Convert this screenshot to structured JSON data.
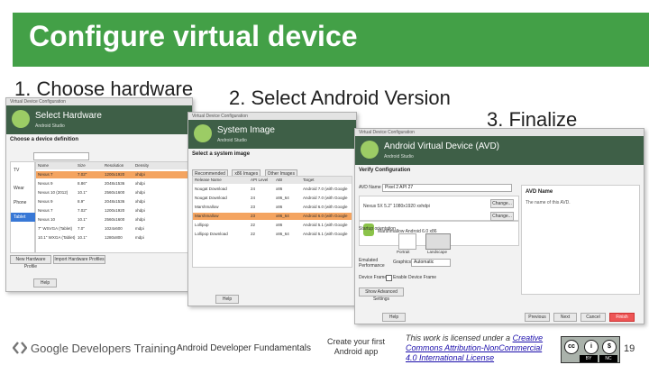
{
  "slide": {
    "title": "Configure virtual device",
    "steps": [
      "1. Choose hardware",
      "2. Select Android Version",
      "3. Finalize"
    ],
    "page_number": "19",
    "colors": {
      "header": "#43a047",
      "selection": "#f4a460",
      "primary_button": "#e55555"
    }
  },
  "window1": {
    "titlebar": "Virtual Device Configuration",
    "header_title": "Select Hardware",
    "header_sub": "Android Studio",
    "section": "Choose a device definition",
    "categories": [
      "TV",
      "Wear",
      "Phone",
      "Tablet"
    ],
    "columns": [
      "Category",
      "Name",
      "Size",
      "Resolution",
      "Density"
    ],
    "rows": [
      [
        "",
        "Nexus 7",
        "7.02\"",
        "1200x1920",
        "xhdpi"
      ],
      [
        "",
        "Nexus 9",
        "8.86\"",
        "2048x1536",
        "xhdpi"
      ],
      [
        "",
        "Nexus 10 (2012)",
        "10.1\"",
        "2560x1600",
        "xhdpi"
      ],
      [
        "",
        "Nexus 9",
        "8.9\"",
        "2048x1536",
        "xhdpi"
      ],
      [
        "",
        "Nexus 7",
        "7.02\"",
        "1200x1920",
        "xhdpi"
      ],
      [
        "",
        "Nexus 10",
        "10.1\"",
        "2560x1600",
        "xhdpi"
      ],
      [
        "",
        "7\" WSVGA (Tablet)",
        "7.0\"",
        "1024x600",
        "mdpi"
      ],
      [
        "",
        "10.1\" WXGA (Tablet)",
        "10.1\"",
        "1280x800",
        "mdpi"
      ]
    ],
    "buttons": [
      "New Hardware Profile",
      "Import Hardware Profiles",
      "Help"
    ]
  },
  "window2": {
    "titlebar": "Virtual Device Configuration",
    "header_title": "System Image",
    "header_sub": "Android Studio",
    "section": "Select a system image",
    "tabs": [
      "Recommended",
      "x86 Images",
      "Other Images"
    ],
    "columns": [
      "Release Name",
      "API Level",
      "ABI",
      "Target"
    ],
    "rows": [
      [
        "Nougat Download",
        "24",
        "x86",
        "Android 7.0 (with Google"
      ],
      [
        "Nougat Download",
        "24",
        "x86_64",
        "Android 7.0 (with Google"
      ],
      [
        "Marshmallow",
        "23",
        "x86",
        "Android 6.0 (with Google"
      ],
      [
        "Marshmallow",
        "23",
        "x86_64",
        "Android 6.0 (with Google"
      ],
      [
        "Lollipop",
        "22",
        "x86",
        "Android 5.1 (with Google"
      ],
      [
        "Lollipop Download",
        "22",
        "x86_64",
        "Android 5.1 (with Google"
      ]
    ],
    "buttons": [
      "Help"
    ]
  },
  "window3": {
    "titlebar": "Virtual Device Configuration",
    "header_title": "Android Virtual Device (AVD)",
    "header_sub": "Android Studio",
    "section": "Verify Configuration",
    "avd_name_label": "AVD Name",
    "avd_name_value": "Pixel 2 API 27",
    "side_title": "AVD Name",
    "side_text": "The name of this AVD.",
    "device_value": "Nexus 5X  5.2\" 1080x1920 xxhdpi",
    "image_value": "Marshmallow  Android 6.0 x86",
    "change_label": "Change...",
    "orientation_label": "Startup orientation",
    "orientations": [
      "Portrait",
      "Landscape"
    ],
    "emulated_label": "Emulated Performance",
    "graphics_label": "Graphics:",
    "graphics_value": "Automatic",
    "frame_label": "Device Frame",
    "frame_checkbox": "Enable Device Frame",
    "advanced_button": "Show Advanced Settings",
    "buttons": [
      "Help",
      "Previous",
      "Next",
      "Cancel",
      "Finish"
    ]
  },
  "footer": {
    "brand": "Google Developers Training",
    "course": "Android Developer Fundamentals",
    "lesson": "Create your first Android app",
    "license_prefix": "This work is licensed under a",
    "license_link": "Creative Commons Attribution-NonCommercial 4.0 International License",
    "cc_labels": [
      "BY",
      "NC"
    ]
  }
}
